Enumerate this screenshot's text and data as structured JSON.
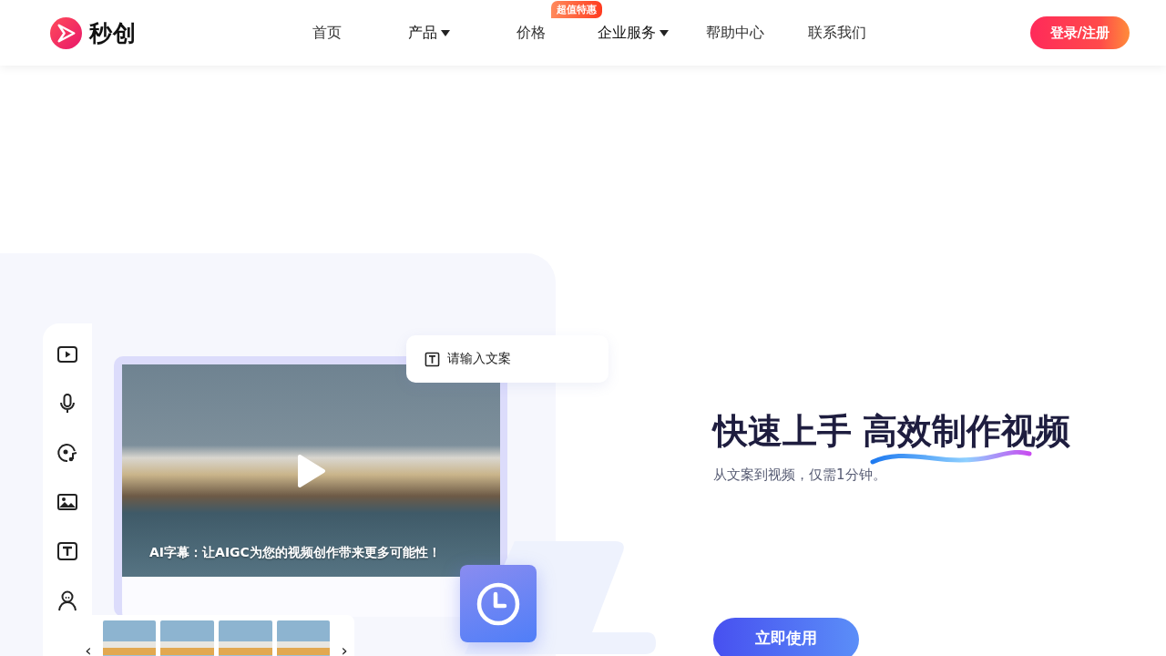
{
  "header": {
    "logo_text": "秒创",
    "nav": [
      {
        "label": "首页",
        "kind": "link"
      },
      {
        "label": "产品",
        "kind": "dropdown"
      },
      {
        "label": "价格",
        "kind": "link",
        "badge": "超值特惠"
      },
      {
        "label": "企业服务",
        "kind": "dropdown"
      },
      {
        "label": "帮助中心",
        "kind": "link"
      },
      {
        "label": "联系我们",
        "kind": "link"
      }
    ],
    "login_button": "登录/注册"
  },
  "editor_preview": {
    "tools": [
      {
        "kind": "video"
      },
      {
        "kind": "mic"
      },
      {
        "kind": "music"
      },
      {
        "kind": "image"
      },
      {
        "kind": "text"
      },
      {
        "kind": "avatar"
      }
    ],
    "text_input": {
      "placeholder": "请输入文案"
    },
    "caption": "AI字幕：让AIGC为您的视频创作带来更多可能性！",
    "thumbnail_count_prev": "‹",
    "thumbnail_count_next": "›",
    "thumbnails": [
      {
        "kind": "photo"
      },
      {
        "kind": "photo"
      },
      {
        "kind": "photo"
      },
      {
        "kind": "photo"
      }
    ]
  },
  "hero": {
    "title_first": "快速上手",
    "title_second": "高效制作视频",
    "subtitle": "从文案到视频，仅需1分钟。",
    "cta": "立即使用"
  }
}
